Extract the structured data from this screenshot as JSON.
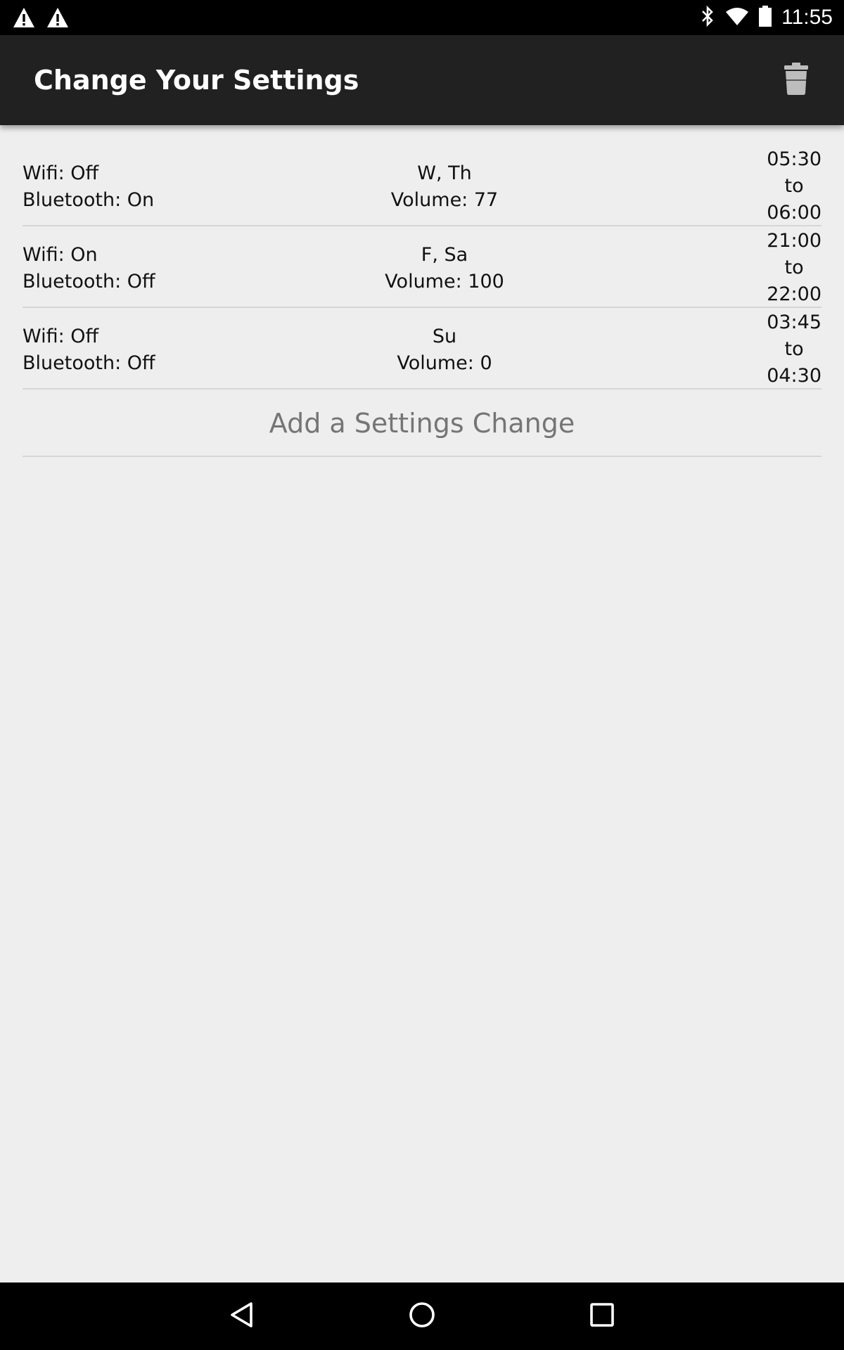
{
  "status_bar": {
    "time": "11:55",
    "left_icons": [
      "warning-icon",
      "warning-icon"
    ],
    "right_icons": [
      "bluetooth-icon",
      "wifi-icon",
      "battery-icon"
    ]
  },
  "app_bar": {
    "title": "Change Your Settings",
    "action_icon": "trash-icon"
  },
  "schedule_items": [
    {
      "wifi": "Wifi: Off",
      "bluetooth": "Bluetooth: On",
      "days": "W, Th",
      "volume": "Volume: 77",
      "start": "05:30",
      "separator": "to",
      "end": "06:00"
    },
    {
      "wifi": "Wifi: On",
      "bluetooth": "Bluetooth: Off",
      "days": "F, Sa",
      "volume": "Volume: 100",
      "start": "21:00",
      "separator": "to",
      "end": "22:00"
    },
    {
      "wifi": "Wifi: Off",
      "bluetooth": "Bluetooth: Off",
      "days": "Su",
      "volume": "Volume: 0",
      "start": "03:45",
      "separator": "to",
      "end": "04:30"
    }
  ],
  "add_button": {
    "label": "Add a Settings Change"
  },
  "nav_bar": {
    "icons": [
      "back-icon",
      "home-icon",
      "recents-icon"
    ]
  },
  "colors": {
    "status_bar": "#000000",
    "app_bar": "#212121",
    "background": "#eeeeee",
    "add_text": "#757575"
  }
}
